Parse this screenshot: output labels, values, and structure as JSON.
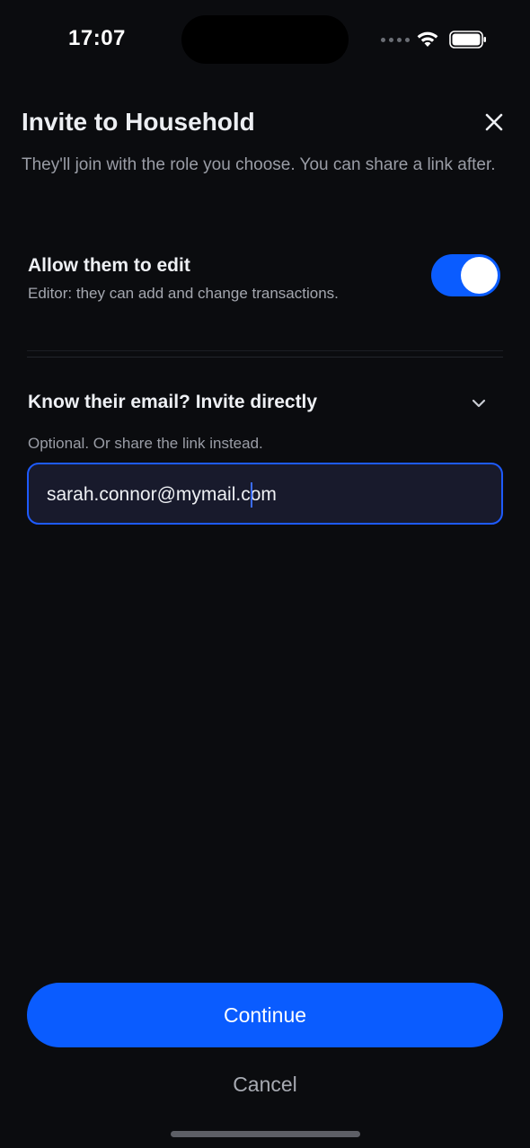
{
  "status_bar": {
    "time": "17:07",
    "icons": [
      "signal-icon",
      "wifi-icon",
      "battery-icon"
    ]
  },
  "header": {
    "title": "Invite to Household",
    "close_icon": "close-icon",
    "subtitle": "They'll join with the role you choose. You can share a link after."
  },
  "edit_permission": {
    "label": "Allow them to edit",
    "description": "Editor: they can add and change transactions.",
    "enabled": true
  },
  "email_section": {
    "heading": "Know their email? Invite directly",
    "chevron_icon": "chevron-down-icon",
    "hint": "Optional. Or share the link instead.",
    "email_value": "sarah.connor@mymail.com"
  },
  "actions": {
    "continue_label": "Continue",
    "cancel_label": "Cancel"
  },
  "colors": {
    "background": "#0b0c0f",
    "accent": "#0a5cff",
    "input_background": "#181a2c",
    "input_border": "#1e5bff"
  }
}
